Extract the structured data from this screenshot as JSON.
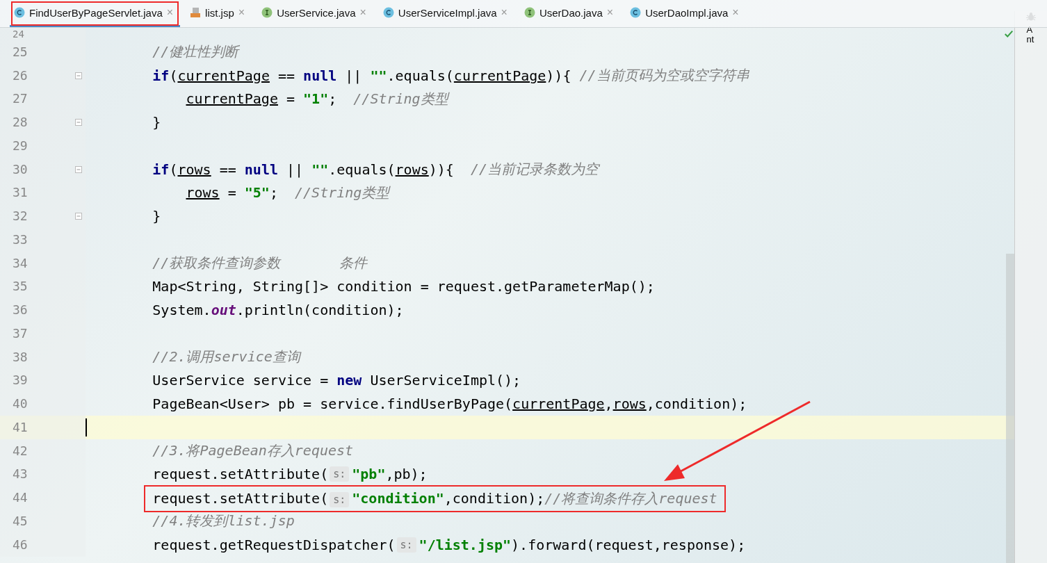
{
  "tabs": [
    {
      "label": "FindUserByPageServlet.java",
      "kind": "class",
      "selected": true,
      "highlighted": true,
      "close": "×"
    },
    {
      "label": "list.jsp",
      "kind": "jsp",
      "selected": false,
      "highlighted": false,
      "close": "×"
    },
    {
      "label": "UserService.java",
      "kind": "interface",
      "selected": false,
      "highlighted": false,
      "close": "×"
    },
    {
      "label": "UserServiceImpl.java",
      "kind": "class",
      "selected": false,
      "highlighted": false,
      "close": "×"
    },
    {
      "label": "UserDao.java",
      "kind": "interface",
      "selected": false,
      "highlighted": false,
      "close": "×"
    },
    {
      "label": "UserDaoImpl.java",
      "kind": "class",
      "selected": false,
      "highlighted": false,
      "close": "×"
    }
  ],
  "side_panel": {
    "label": "Ant"
  },
  "editor": {
    "lines": [
      {
        "number": "24",
        "fold": false,
        "current": false,
        "boxed": false
      },
      {
        "number": "25",
        "fold": false,
        "current": false,
        "boxed": false,
        "tokens": [
          {
            "kind": "comment",
            "t": "//健壮性判断"
          }
        ]
      },
      {
        "number": "26",
        "fold": true,
        "current": false,
        "boxed": false,
        "tokens": [
          {
            "kind": "keyword",
            "t": "if"
          },
          {
            "kind": "plain",
            "t": "("
          },
          {
            "kind": "variable",
            "t": "currentPage"
          },
          {
            "kind": "plain",
            "t": " == "
          },
          {
            "kind": "keyword",
            "t": "null"
          },
          {
            "kind": "plain",
            "t": " || "
          },
          {
            "kind": "string",
            "t": "\"\""
          },
          {
            "kind": "plain",
            "t": ".equals("
          },
          {
            "kind": "variable",
            "t": "currentPage"
          },
          {
            "kind": "plain",
            "t": ")){ "
          },
          {
            "kind": "comment",
            "t": "//当前页码为空或空字符串"
          }
        ],
        "children": [
          {
            "number": "27",
            "fold": false,
            "current": false,
            "boxed": false,
            "tokens": [
              {
                "kind": "variable",
                "t": "currentPage"
              },
              {
                "kind": "plain",
                "t": " = "
              },
              {
                "kind": "string",
                "t": "\"1\""
              },
              {
                "kind": "plain",
                "t": ";  "
              },
              {
                "kind": "comment",
                "t": "//String类型"
              }
            ]
          }
        ]
      },
      {
        "number": "28",
        "fold": true,
        "current": false,
        "boxed": false,
        "tokens": [
          {
            "kind": "plain",
            "t": "}"
          }
        ]
      },
      {
        "number": "29",
        "fold": false,
        "current": false,
        "boxed": false
      },
      {
        "number": "30",
        "fold": true,
        "current": false,
        "boxed": false,
        "tokens": [
          {
            "kind": "keyword",
            "t": "if"
          },
          {
            "kind": "plain",
            "t": "("
          },
          {
            "kind": "variable",
            "t": "rows"
          },
          {
            "kind": "plain",
            "t": " == "
          },
          {
            "kind": "keyword",
            "t": "null"
          },
          {
            "kind": "plain",
            "t": " || "
          },
          {
            "kind": "string",
            "t": "\"\""
          },
          {
            "kind": "plain",
            "t": ".equals("
          },
          {
            "kind": "variable",
            "t": "rows"
          },
          {
            "kind": "plain",
            "t": ")){  "
          },
          {
            "kind": "comment",
            "t": "//当前记录条数为空"
          }
        ],
        "children": [
          {
            "number": "31",
            "fold": false,
            "current": false,
            "boxed": false,
            "tokens": [
              {
                "kind": "variable",
                "t": "rows"
              },
              {
                "kind": "plain",
                "t": " = "
              },
              {
                "kind": "string",
                "t": "\"5\""
              },
              {
                "kind": "plain",
                "t": ";  "
              },
              {
                "kind": "comment",
                "t": "//String类型"
              }
            ]
          }
        ]
      },
      {
        "number": "32",
        "fold": true,
        "current": false,
        "boxed": false,
        "tokens": [
          {
            "kind": "plain",
            "t": "}"
          }
        ]
      },
      {
        "number": "33",
        "fold": false,
        "current": false,
        "boxed": false
      },
      {
        "number": "34",
        "fold": false,
        "current": false,
        "boxed": false,
        "tokens": [
          {
            "kind": "comment",
            "t": "//获取条件查询参数       条件"
          }
        ]
      },
      {
        "number": "35",
        "fold": false,
        "current": false,
        "boxed": false,
        "tokens": [
          {
            "kind": "plain",
            "t": "Map<String, String[]> condition = request.getParameterMap();"
          }
        ]
      },
      {
        "number": "36",
        "fold": false,
        "current": false,
        "boxed": false,
        "tokens": [
          {
            "kind": "plain",
            "t": "System."
          },
          {
            "kind": "field",
            "t": "out"
          },
          {
            "kind": "plain",
            "t": ".println(condition);"
          }
        ]
      },
      {
        "number": "37",
        "fold": false,
        "current": false,
        "boxed": false
      },
      {
        "number": "38",
        "fold": false,
        "current": false,
        "boxed": false,
        "tokens": [
          {
            "kind": "comment",
            "t": "//2.调用service查询"
          }
        ]
      },
      {
        "number": "39",
        "fold": false,
        "current": false,
        "boxed": false,
        "tokens": [
          {
            "kind": "plain",
            "t": "UserService service = "
          },
          {
            "kind": "keyword",
            "t": "new"
          },
          {
            "kind": "plain",
            "t": " UserServiceImpl();"
          }
        ]
      },
      {
        "number": "40",
        "fold": false,
        "current": false,
        "boxed": false,
        "tokens": [
          {
            "kind": "plain",
            "t": "PageBean<User> pb = service.findUserByPage("
          },
          {
            "kind": "variable",
            "t": "currentPage"
          },
          {
            "kind": "plain",
            "t": ","
          },
          {
            "kind": "variable",
            "t": "rows"
          },
          {
            "kind": "plain",
            "t": ",condition);"
          }
        ]
      },
      {
        "number": "41",
        "fold": false,
        "current": true,
        "boxed": false
      },
      {
        "number": "42",
        "fold": false,
        "current": false,
        "boxed": false,
        "tokens": [
          {
            "kind": "comment",
            "t": "//3.将PageBean存入request"
          }
        ]
      },
      {
        "number": "43",
        "fold": false,
        "current": false,
        "boxed": false,
        "tokens": [
          {
            "kind": "plain",
            "t": "request.setAttribute("
          },
          {
            "kind": "hint",
            "t": "s:"
          },
          {
            "kind": "string",
            "t": "\"pb\""
          },
          {
            "kind": "plain",
            "t": ",pb);"
          }
        ]
      },
      {
        "number": "44",
        "fold": false,
        "current": false,
        "boxed": true,
        "tokens": [
          {
            "kind": "plain",
            "t": "request.setAttribute("
          },
          {
            "kind": "hint",
            "t": "s:"
          },
          {
            "kind": "string",
            "t": "\"condition\""
          },
          {
            "kind": "plain",
            "t": ",condition);"
          },
          {
            "kind": "comment",
            "t": "//将查询条件存入request"
          }
        ]
      },
      {
        "number": "45",
        "fold": false,
        "current": false,
        "boxed": false,
        "tokens": [
          {
            "kind": "comment",
            "t": "//4.转发到list.jsp"
          }
        ]
      },
      {
        "number": "46",
        "fold": false,
        "current": false,
        "boxed": false,
        "tokens": [
          {
            "kind": "plain",
            "t": "request.getRequestDispatcher("
          },
          {
            "kind": "hint",
            "t": "s:"
          },
          {
            "kind": "string",
            "t": "\"/list.jsp\""
          },
          {
            "kind": "plain",
            "t": ").forward(request,response);"
          }
        ]
      }
    ]
  }
}
